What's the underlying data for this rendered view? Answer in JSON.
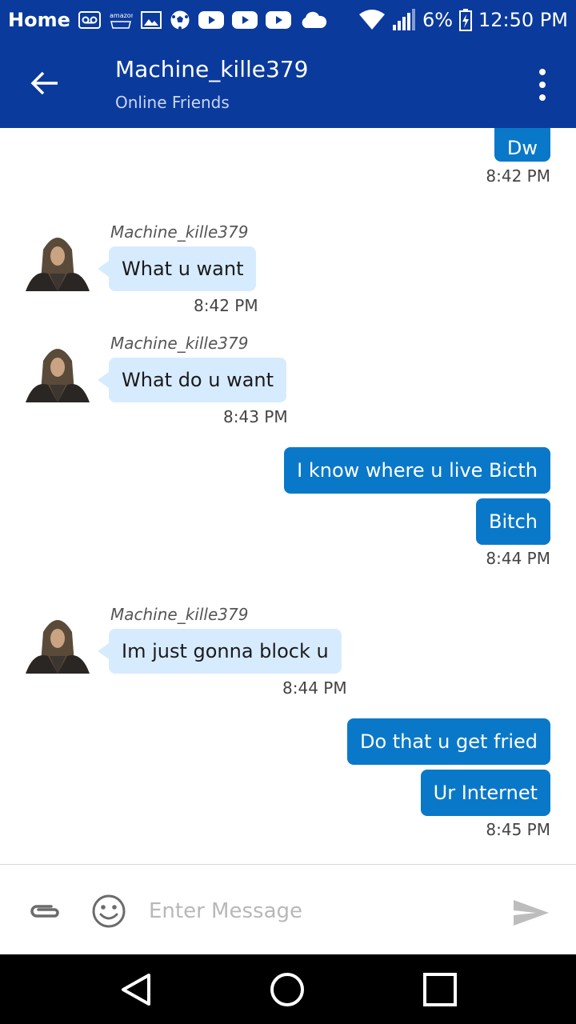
{
  "status_bar": {
    "left_label": "Home",
    "battery": "6%",
    "time": "12:50 PM",
    "icons": [
      "voicemail-icon",
      "amazon-icon",
      "image-icon",
      "soccer-icon",
      "youtube-icon",
      "youtube-icon",
      "youtube-icon",
      "cloud-icon",
      "wifi-icon",
      "signal-icon",
      "battery-icon"
    ]
  },
  "app_bar": {
    "title": "Machine_kille379",
    "subtitle": "Online Friends",
    "back_icon": "arrow-left-icon",
    "menu_icon": "more-vert-icon"
  },
  "messages": [
    {
      "direction": "out",
      "text": "Dw",
      "time": "8:42 PM"
    },
    {
      "direction": "in",
      "sender": "Machine_kille379",
      "text": "What u want",
      "time": "8:42 PM"
    },
    {
      "direction": "in",
      "sender": "Machine_kille379",
      "text": "What do u want",
      "time": "8:43 PM"
    },
    {
      "direction": "out",
      "text": "I know where u live Bicth"
    },
    {
      "direction": "out",
      "text": "Bitch",
      "time": "8:44 PM"
    },
    {
      "direction": "in",
      "sender": "Machine_kille379",
      "text": "Im just gonna block u",
      "time": "8:44 PM"
    },
    {
      "direction": "out",
      "text": "Do that u get fried"
    },
    {
      "direction": "out",
      "text": "Ur Internet",
      "time": "8:45 PM"
    }
  ],
  "input_bar": {
    "placeholder": "Enter Message",
    "value": "",
    "attach_icon": "paperclip-icon",
    "emoji_icon": "smiley-icon",
    "send_icon": "send-icon"
  },
  "nav_bar": {
    "icons": [
      "back-triangle-icon",
      "home-circle-icon",
      "recents-square-icon"
    ]
  },
  "colors": {
    "primary": "#0a3a9c",
    "outgoing_bubble": "#0a78c9",
    "incoming_bubble": "#d7ebff"
  }
}
